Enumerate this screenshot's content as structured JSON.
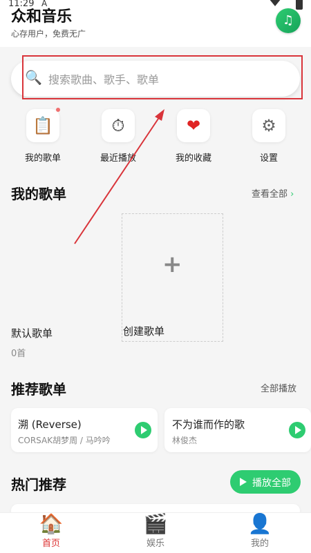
{
  "status_bar": {
    "time": "11:29",
    "indicator": "A"
  },
  "header": {
    "title": "众和音乐",
    "subtitle": "心存用户，免费无广",
    "logo_icon": "music-note-icon"
  },
  "search": {
    "placeholder": "搜索歌曲、歌手、歌单"
  },
  "quick_actions": [
    {
      "label": "我的歌单",
      "icon": "clipboard-icon",
      "glyph": "📋",
      "badge": true
    },
    {
      "label": "最近播放",
      "icon": "stopwatch-icon",
      "glyph": "⏱"
    },
    {
      "label": "我的收藏",
      "icon": "heart-icon",
      "glyph": "❤"
    },
    {
      "label": "设置",
      "icon": "gear-icon",
      "glyph": "⚙"
    }
  ],
  "my_playlists": {
    "title": "我的歌单",
    "view_all": "查看全部",
    "default": {
      "name": "默认歌单",
      "count": "0首"
    },
    "create": {
      "label": "创建歌单"
    }
  },
  "recommended": {
    "title": "推荐歌单",
    "play_all": "全部播放",
    "items": [
      {
        "title": "溯 (Reverse)",
        "artist": "CORSAK胡梦周 / 马吟吟"
      },
      {
        "title": "不为谁而作的歌",
        "artist": "林俊杰"
      }
    ]
  },
  "hot": {
    "title": "热门推荐",
    "play_all": "播放全部"
  },
  "bottom_nav": [
    {
      "label": "首页",
      "icon": "home-icon",
      "glyph": "🏠",
      "active": true
    },
    {
      "label": "娱乐",
      "icon": "clapperboard-icon",
      "glyph": "🎬"
    },
    {
      "label": "我的",
      "icon": "user-icon",
      "glyph": "👤"
    }
  ],
  "colors": {
    "accent": "#2ecc71",
    "highlight_box": "#d9343a",
    "nav_active": "#dd3333"
  }
}
